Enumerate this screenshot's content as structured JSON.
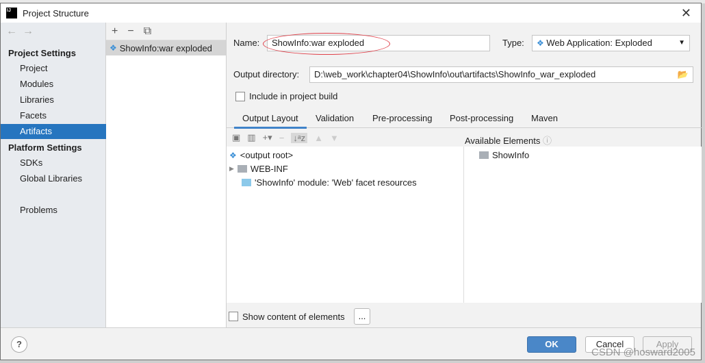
{
  "window": {
    "title": "Project Structure"
  },
  "sidebar": {
    "project_settings": "Project Settings",
    "items": [
      "Project",
      "Modules",
      "Libraries",
      "Facets",
      "Artifacts"
    ],
    "platform_settings": "Platform Settings",
    "platform_items": [
      "SDKs",
      "Global Libraries"
    ],
    "problems": "Problems",
    "selected": "Artifacts"
  },
  "artifacts": {
    "items": [
      "ShowInfo:war exploded"
    ]
  },
  "form": {
    "name_label": "Name:",
    "name_value": "ShowInfo:war exploded",
    "type_label": "Type:",
    "type_value": "Web Application: Exploded",
    "output_label": "Output directory:",
    "output_value": "D:\\web_work\\chapter04\\ShowInfo\\out\\artifacts\\ShowInfo_war_exploded",
    "include_label": "Include in project build",
    "include_checked": false
  },
  "tabs": [
    "Output Layout",
    "Validation",
    "Pre-processing",
    "Post-processing",
    "Maven"
  ],
  "tree": [
    "<output root>",
    "WEB-INF",
    "'ShowInfo' module: 'Web' facet resources"
  ],
  "available": {
    "title": "Available Elements",
    "items": [
      "ShowInfo"
    ]
  },
  "show_content_label": "Show content of elements",
  "ellipsis_label": "...",
  "buttons": {
    "ok": "OK",
    "cancel": "Cancel",
    "apply": "Apply",
    "help": "?"
  },
  "watermark": "CSDN @hosward2005",
  "colors": {
    "accent": "#2675bf",
    "ok": "#4a87c8",
    "highlight": "#e0404a"
  }
}
